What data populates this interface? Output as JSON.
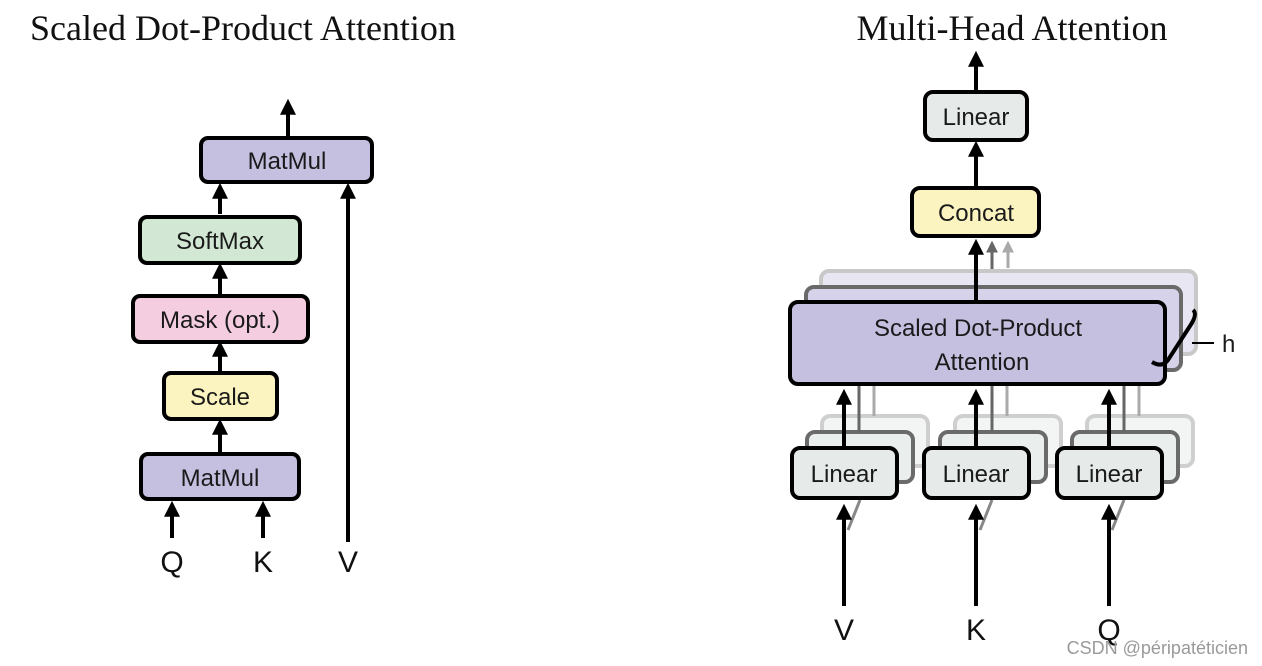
{
  "left": {
    "title": "Scaled Dot-Product Attention",
    "boxes": {
      "matmul_top": "MatMul",
      "softmax": "SoftMax",
      "mask": "Mask (opt.)",
      "scale": "Scale",
      "matmul_bottom": "MatMul"
    },
    "inputs": {
      "q": "Q",
      "k": "K",
      "v": "V"
    }
  },
  "right": {
    "title": "Multi-Head Attention",
    "boxes": {
      "linear_out": "Linear",
      "concat": "Concat",
      "sdpa_line1": "Scaled Dot-Product",
      "sdpa_line2": "Attention",
      "linear_v": "Linear",
      "linear_k": "Linear",
      "linear_q": "Linear"
    },
    "heads_label": "h",
    "inputs": {
      "v": "V",
      "k": "K",
      "q": "Q"
    }
  },
  "colors": {
    "purple": "#c5bfe0",
    "green": "#d2e8d4",
    "pink": "#f5cde0",
    "yellow": "#fbf4c0",
    "gray": "#e6ebea"
  },
  "watermark": "CSDN @péripatéticien"
}
